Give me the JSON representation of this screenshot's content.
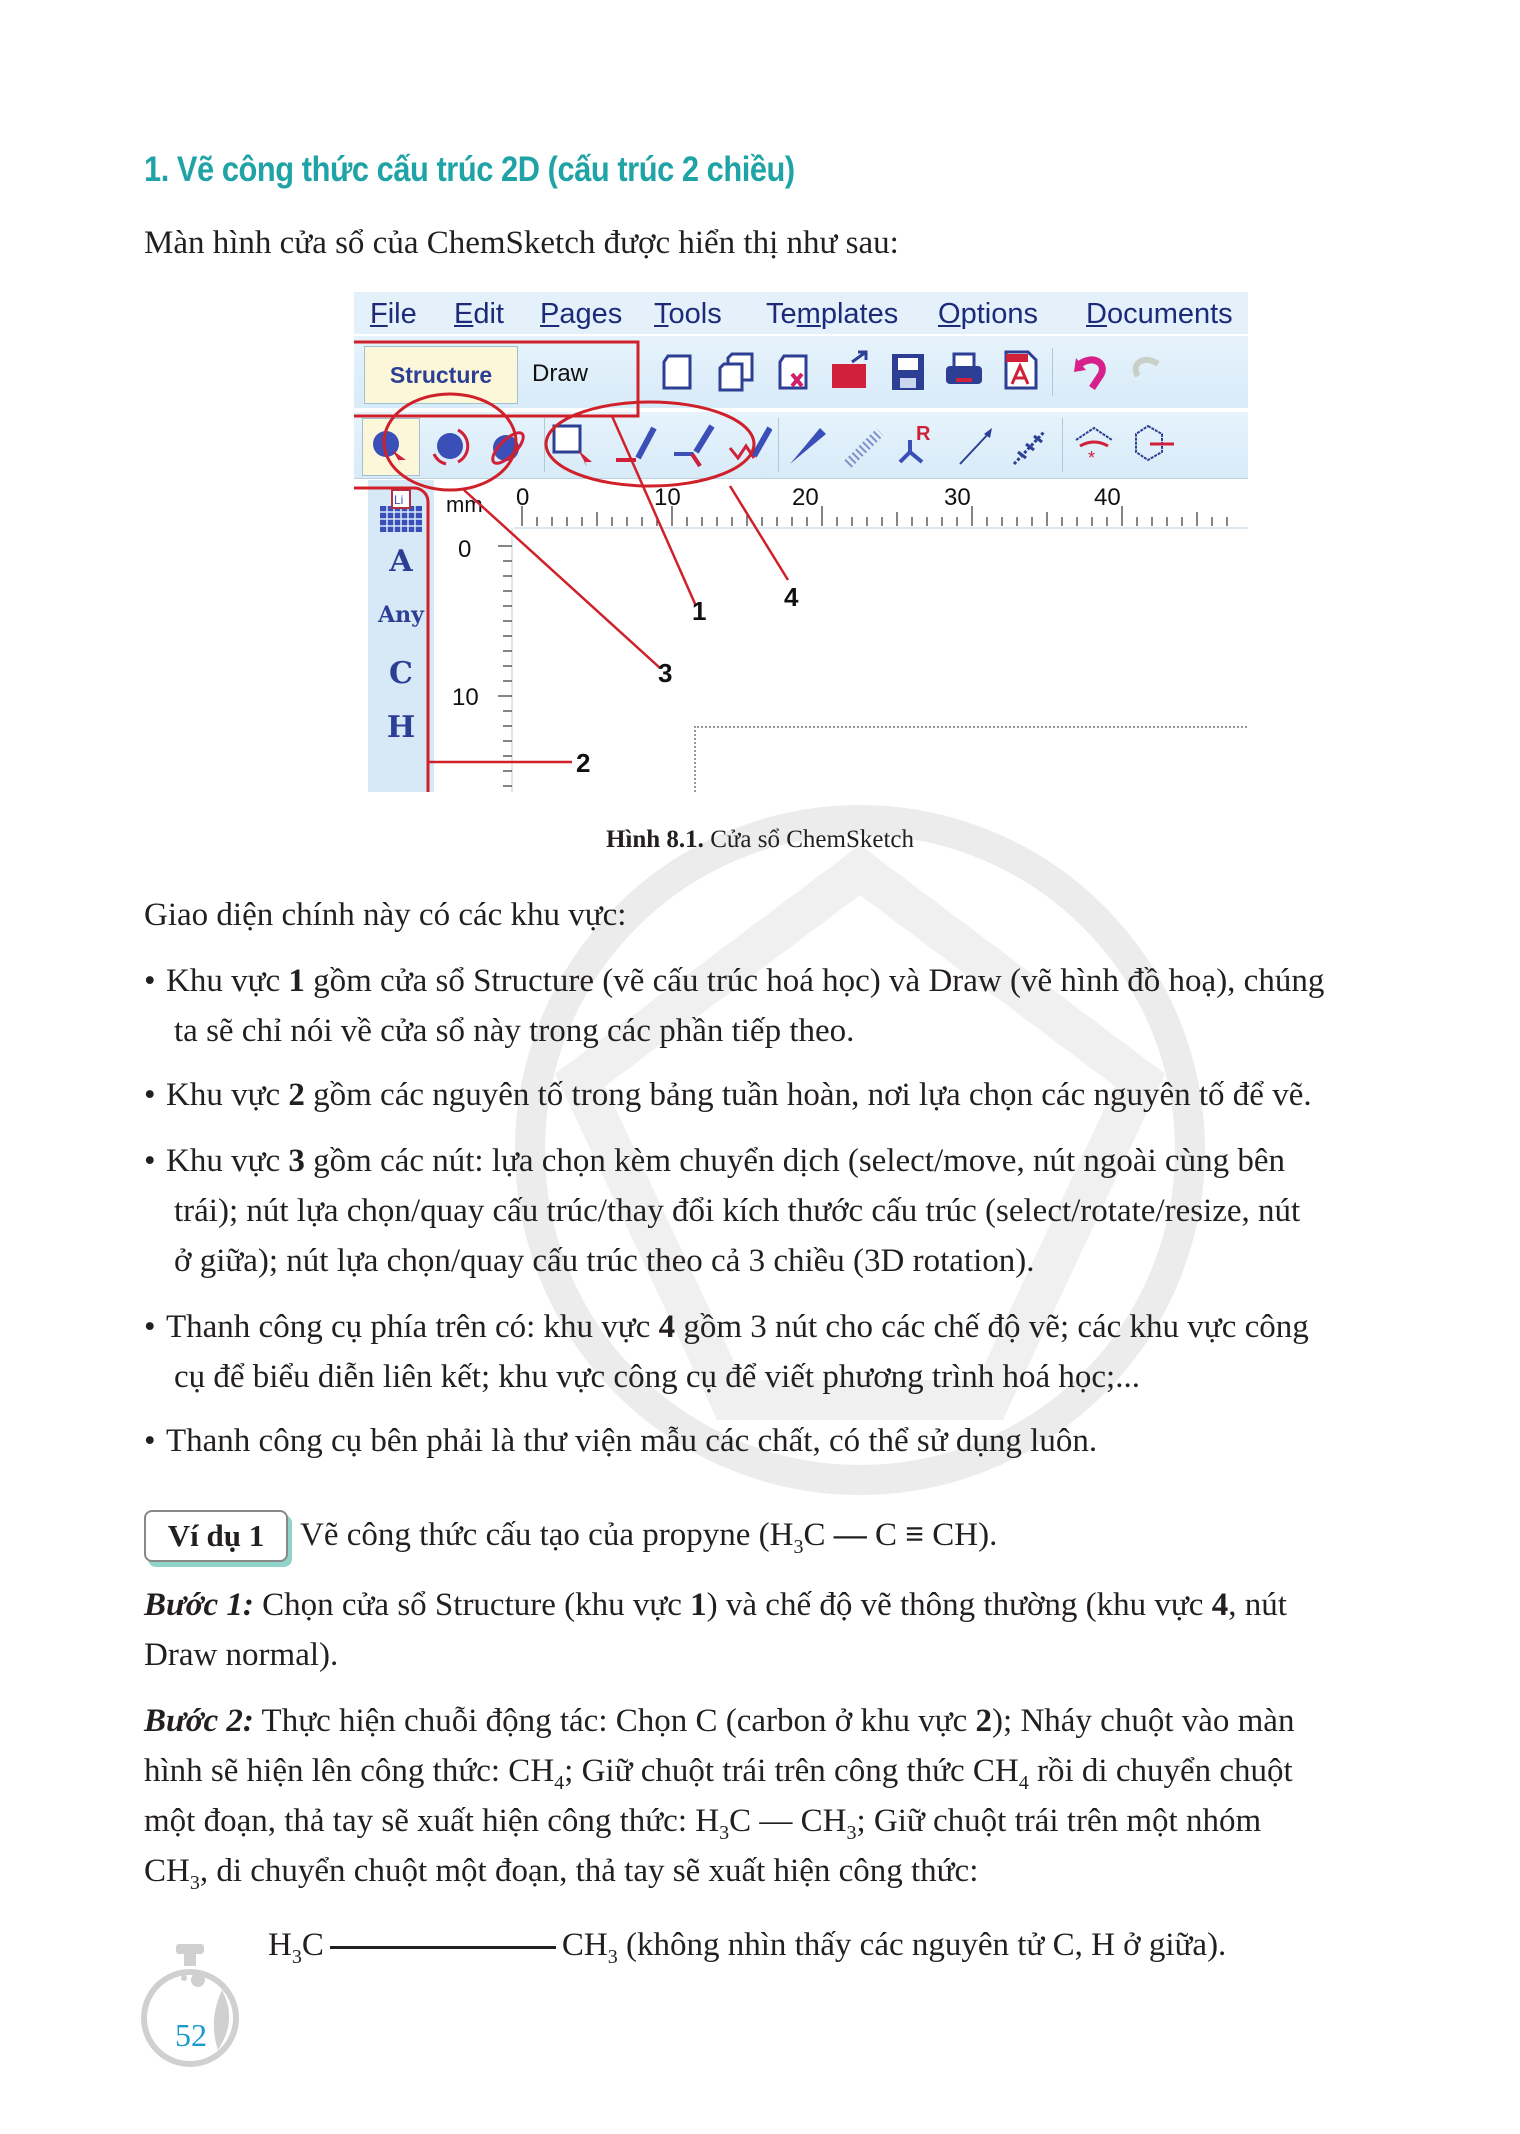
{
  "heading": "1. Vẽ công thức cấu trúc 2D (cấu trúc 2 chiều)",
  "intro": "Màn hình cửa sổ của ChemSketch được hiển thị như sau:",
  "screenshot": {
    "menu": [
      {
        "label": "File",
        "mnemonic": "F",
        "rest": "ile"
      },
      {
        "label": "Edit",
        "mnemonic": "E",
        "rest": "dit"
      },
      {
        "label": "Pages",
        "mnemonic": "P",
        "rest": "ages"
      },
      {
        "label": "Tools",
        "mnemonic": "T",
        "rest": "ools"
      },
      {
        "label": "Templates",
        "pre": "Te",
        "mnemonic": "m",
        "rest": "plates"
      },
      {
        "label": "Options",
        "mnemonic": "O",
        "rest": "ptions"
      },
      {
        "label": "Documents",
        "mnemonic": "D",
        "rest": "ocuments"
      }
    ],
    "tabs": {
      "structure": "Structure",
      "draw": "Draw"
    },
    "toolbar_icons": [
      "new-page-icon",
      "duplicate-page-icon",
      "delete-page-icon",
      "open-icon",
      "save-icon",
      "print-icon",
      "pdf-icon",
      "undo-icon",
      "redo-icon"
    ],
    "tool_icons": [
      "select-move-icon",
      "select-rotate-resize-icon",
      "3d-rotation-icon",
      "select-rectangle-icon",
      "draw-normal-icon",
      "draw-continuous-icon",
      "draw-chain-icon",
      "wedge-bond-icon",
      "hashed-bond-icon",
      "r-group-icon",
      "arrow-icon",
      "bond-chain-icon",
      "resonance-icon",
      "ring-icon"
    ],
    "ruler_unit": "mm",
    "ruler_top_labels": [
      "0",
      "10",
      "20",
      "30",
      "40"
    ],
    "ruler_left_labels": [
      "0",
      "10"
    ],
    "elements": [
      "A",
      "Any",
      "C",
      "H"
    ],
    "periodic_table_label": "Li",
    "callouts": [
      "1",
      "2",
      "3",
      "4"
    ],
    "highlight_color": "#d0202a"
  },
  "caption": {
    "label": "Hình 8.1.",
    "text": "Cửa sổ ChemSketch"
  },
  "areas_intro": "Giao diện chính này có các khu vực:",
  "bullets": [
    {
      "pre": "Khu vực ",
      "bold": "1",
      "post": " gồm cửa sổ Structure (vẽ cấu trúc hoá học) và Draw (vẽ hình đồ hoạ), chúng",
      "cont": "ta sẽ chỉ nói về cửa sổ này trong các phần tiếp theo."
    },
    {
      "pre": "Khu vực ",
      "bold": "2",
      "post": " gồm các nguyên tố trong bảng tuần hoàn, nơi lựa chọn các nguyên tố để vẽ."
    },
    {
      "pre": "Khu vực ",
      "bold": "3",
      "post": " gồm các nút: lựa chọn kèm chuyển dịch (select/move, nút ngoài cùng bên",
      "cont": "trái); nút lựa chọn/quay cấu trúc/thay đổi kích thước cấu trúc (select/rotate/resize, nút",
      "cont2": "ở giữa); nút lựa chọn/quay cấu trúc theo cả 3 chiều (3D rotation)."
    },
    {
      "pre": "Thanh công cụ phía trên có: khu vực ",
      "bold": "4",
      "post": " gồm 3 nút cho các chế độ vẽ; các khu vực công",
      "cont": "cụ để biểu diễn liên kết; khu vực công cụ để viết phương trình hoá học;..."
    },
    {
      "pre": "Thanh công cụ bên phải là thư viện mẫu các chất, có thể sử dụng luôn."
    }
  ],
  "example": {
    "badge": "Ví dụ 1",
    "title_pre": "Vẽ công thức cấu tạo của propyne (H",
    "title_sub": "3",
    "title_mid": "C ",
    "title_bond1": "—",
    "title_c": " C ",
    "title_bond3": "≡",
    "title_end": " CH)."
  },
  "step1": {
    "label": "Bước 1:",
    "text_a": " Chọn cửa sổ Structure (khu vực ",
    "bold_a": "1",
    "text_b": ") và chế độ vẽ thông thường (khu vực ",
    "bold_b": "4",
    "text_c": ", nút",
    "line2": "Draw normal)."
  },
  "step2": {
    "label": "Bước 2:",
    "l1a": " Thực hiện chuỗi động tác: Chọn C (carbon ở khu vực ",
    "l1b": "2",
    "l1c": "); Nháy chuột vào màn",
    "l2a": "hình sẽ hiện lên công thức: CH",
    "l2s1": "4",
    "l2b": "; Giữ chuột trái trên công thức CH",
    "l2s2": "4",
    "l2c": " rồi di chuyển chuột",
    "l3a": "một đoạn, thả tay sẽ xuất hiện công thức: H",
    "l3s1": "3",
    "l3b": "C — CH",
    "l3s2": "3",
    "l3c": "; Giữ chuột trái trên một nhóm",
    "l4a": "CH",
    "l4s": "3",
    "l4b": ", di chuyển chuột một đoạn, thả tay sẽ xuất hiện công thức:"
  },
  "formula": {
    "left": "H",
    "left_sub": "3",
    "left_c": "C",
    "right": "CH",
    "right_sub": "3",
    "note": " (không nhìn thấy các nguyên tử C, H ở giữa)."
  },
  "page_number": "52",
  "colors": {
    "heading": "#1fa3a6",
    "page_number": "#1b9ad0",
    "accent_red": "#d0202a",
    "icon_blue": "#2c3f94"
  }
}
